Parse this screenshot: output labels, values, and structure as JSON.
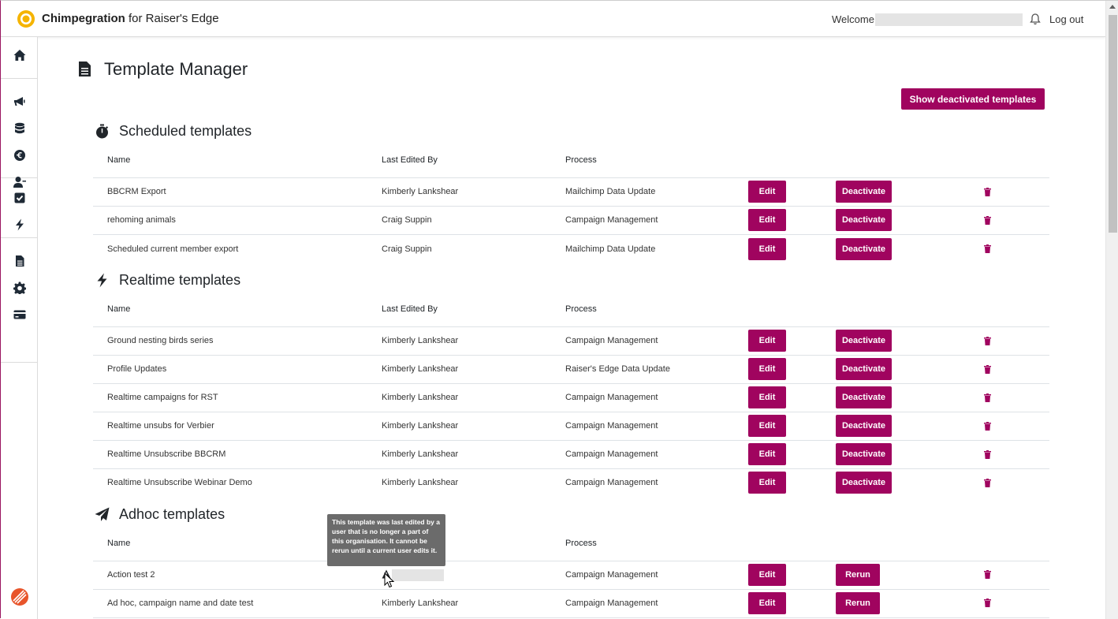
{
  "header": {
    "brand_bold": "Chimpegration",
    "brand_rest": " for Raiser's Edge",
    "welcome": "Welcome,",
    "logout": "Log out"
  },
  "page": {
    "title": "Template Manager",
    "show_deactivated_label": "Show deactivated templates"
  },
  "columns": {
    "name": "Name",
    "last_edited_by": "Last Edited By",
    "process": "Process"
  },
  "buttons": {
    "edit": "Edit",
    "deactivate": "Deactivate",
    "rerun": "Rerun"
  },
  "sections": {
    "scheduled": {
      "title": "Scheduled templates",
      "rows": [
        {
          "name": "BBCRM Export",
          "editor": "Kimberly Lankshear",
          "process": "Mailchimp Data Update"
        },
        {
          "name": "rehoming animals",
          "editor": "Craig Suppin",
          "process": "Campaign Management"
        },
        {
          "name": "Scheduled current member export",
          "editor": "Craig Suppin",
          "process": "Mailchimp Data Update"
        }
      ]
    },
    "realtime": {
      "title": "Realtime templates",
      "rows": [
        {
          "name": "Ground nesting birds series",
          "editor": "Kimberly Lankshear",
          "process": "Campaign Management"
        },
        {
          "name": "Profile Updates",
          "editor": "Kimberly Lankshear",
          "process": "Raiser's Edge Data Update"
        },
        {
          "name": "Realtime campaigns for RST",
          "editor": "Kimberly Lankshear",
          "process": "Campaign Management"
        },
        {
          "name": "Realtime unsubs for Verbier",
          "editor": "Kimberly Lankshear",
          "process": "Campaign Management"
        },
        {
          "name": "Realtime Unsubscribe BBCRM",
          "editor": "Kimberly Lankshear",
          "process": "Campaign Management"
        },
        {
          "name": "Realtime Unsubscribe Webinar Demo",
          "editor": "Kimberly Lankshear",
          "process": "Campaign Management"
        }
      ]
    },
    "adhoc": {
      "title": "Adhoc templates",
      "rows": [
        {
          "name": "Action test 2",
          "editor": "",
          "process": "Campaign Management"
        },
        {
          "name": "Ad hoc, campaign name and date test",
          "editor": "Kimberly Lankshear",
          "process": "Campaign Management"
        }
      ]
    }
  },
  "tooltip": "This template was last edited by a user that is no longer a part of this organisation. It cannot be rerun until a current user edits it.",
  "colors": {
    "accent": "#a0045f",
    "text": "#212529",
    "divider": "#dee2e6"
  },
  "icons": {
    "sidebar": [
      "home-icon",
      "megaphone-icon",
      "database-icon",
      "euro-globe-icon",
      "user-minus-icon",
      "checkbox-icon",
      "bolt-icon",
      "file-icon",
      "gear-icon",
      "credit-card-icon"
    ]
  }
}
